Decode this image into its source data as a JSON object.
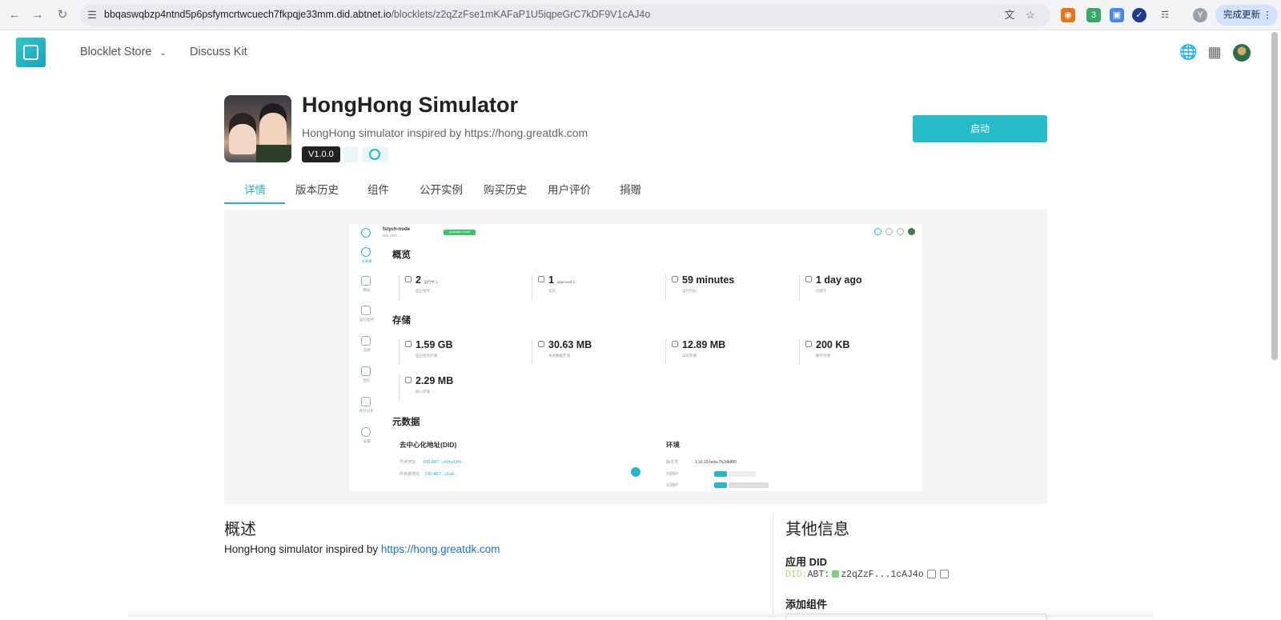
{
  "browser": {
    "url_host": "bbqaswqbzp4ntnd5p6psfymcrtwcuech7fkpqje33mm.did.abtnet.io",
    "url_path": "/blocklets/z2qZzFse1mKAFaP1U5iqpeGrC7kDF9V1cAJ4o",
    "profile_initial": "Y",
    "extension_badge": "3",
    "update_label": "完成更新"
  },
  "header": {
    "nav": [
      "Blocklet Store",
      "Discuss Kit"
    ]
  },
  "product": {
    "title": "HongHong Simulator",
    "subtitle": "HongHong simulator inspired by https://hong.greatdk.com",
    "version": "V1.0.0",
    "launch_label": "启动"
  },
  "tabs": [
    "详情",
    "版本历史",
    "组件",
    "公开实例",
    "购买历史",
    "用户评价",
    "捐赠"
  ],
  "screenshot": {
    "app_name": "fstych-node",
    "app_did": "DID:ABT:...",
    "badge": "production mode",
    "section_overview": "概览",
    "section_storage": "存储",
    "section_meta": "元数据",
    "stats": [
      {
        "value": "2",
        "unit": "运行中 1",
        "label": "蓝石程序"
      },
      {
        "value": "1",
        "unit": "approved 1",
        "label": "成员"
      },
      {
        "value": "59 minutes",
        "unit": "",
        "label": "运行时长"
      },
      {
        "value": "1 day ago",
        "unit": "",
        "label": "创建于"
      }
    ],
    "storage": [
      {
        "value": "1.59 GB",
        "label": "蓝石程序存储"
      },
      {
        "value": "30.63 MB",
        "label": "本地数据存储"
      },
      {
        "value": "12.89 MB",
        "label": "日志存储"
      },
      {
        "value": "200 KB",
        "label": "缓存存储"
      },
      {
        "value": "2.29 MB",
        "label": "核心存储"
      }
    ],
    "meta_did_title": "去中心化地址(DID)",
    "meta_env_title": "环境",
    "meta_rows": [
      {
        "label": "节点地址",
        "value": "DID:ABT:...zWoy1jHe..."
      },
      {
        "label": "所有者地址",
        "value": "DID:ABT:...z1aA..."
      }
    ],
    "env_rows": [
      {
        "label": "版本号",
        "value": "1.16.19-beta-7b2db880"
      },
      {
        "label": "内网IP",
        "value": ""
      },
      {
        "label": "公网IP",
        "value": ""
      }
    ],
    "side_labels": [
      "仪表盘",
      "网站",
      "蓝石程序",
      "品牌",
      "团队",
      "统计分析",
      "设置"
    ]
  },
  "overview": {
    "title": "概述",
    "text": "HongHong simulator inspired by ",
    "link": "https://hong.greatdk.com"
  },
  "other_info": {
    "title": "其他信息",
    "did_label": "应用 DID",
    "did_prefix": "DID:",
    "did_value": "ABT:",
    "did_short": "z2qZzF...1cAJ4o",
    "add_component_label": "添加组件"
  }
}
